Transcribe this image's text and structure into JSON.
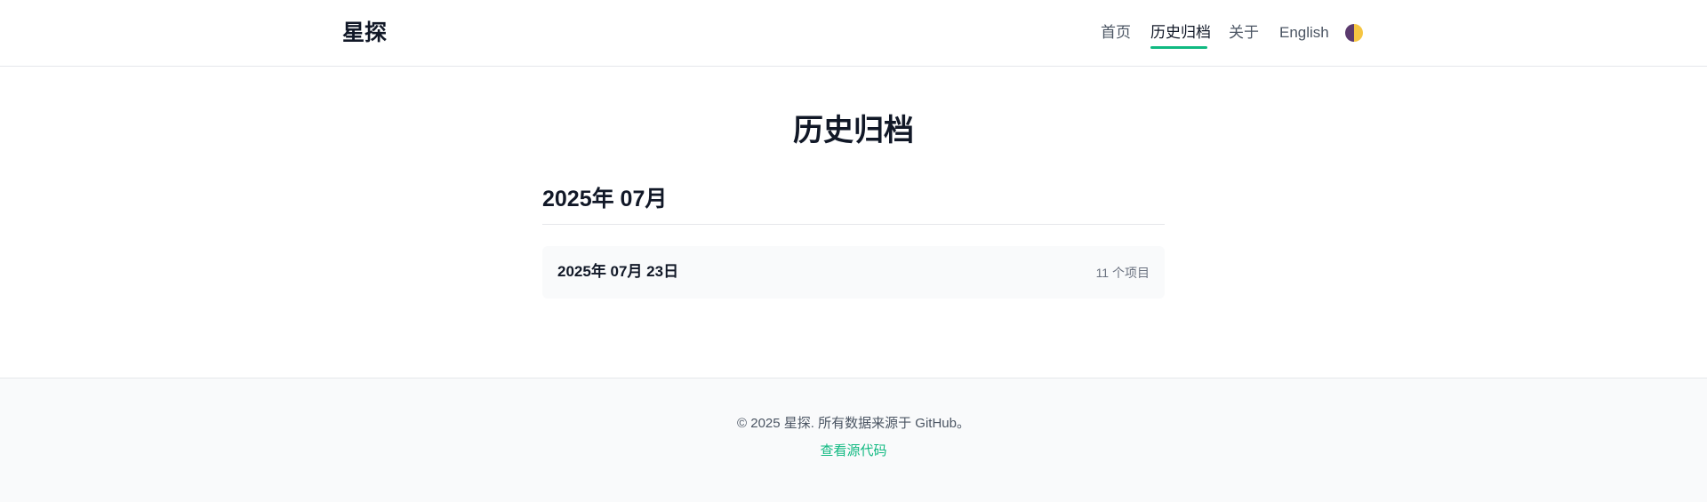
{
  "header": {
    "logo": "星探",
    "nav": [
      {
        "label": "首页",
        "active": false
      },
      {
        "label": "历史归档",
        "active": true
      },
      {
        "label": "关于",
        "active": false
      },
      {
        "label": "English",
        "active": false
      }
    ],
    "theme_toggle_icon": "half-moon-theme-icon",
    "accent_color": "#10b981"
  },
  "main": {
    "title": "历史归档",
    "months": [
      {
        "heading": "2025年 07月",
        "days": [
          {
            "date": "2025年 07月 23日",
            "count": "11 个项目"
          }
        ]
      }
    ]
  },
  "footer": {
    "copyright": "© 2025 星探. 所有数据来源于 GitHub。",
    "source_link": "查看源代码"
  }
}
